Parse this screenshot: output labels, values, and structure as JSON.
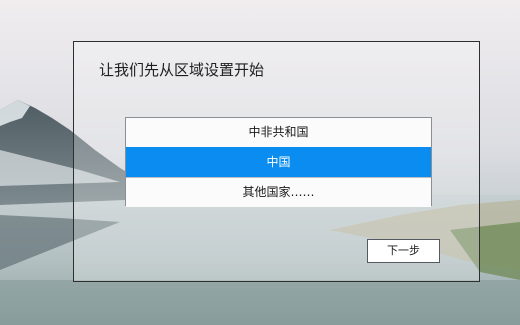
{
  "dialog": {
    "title": "让我们先从区域设置开始",
    "regions": [
      {
        "label": "中非共和国",
        "selected": false
      },
      {
        "label": "中国",
        "selected": true
      },
      {
        "label": "其他国家……",
        "selected": false
      }
    ],
    "next_label": "下一步"
  },
  "colors": {
    "selection_accent": "#0a8cf0",
    "dialog_border": "#2e2e2e"
  }
}
